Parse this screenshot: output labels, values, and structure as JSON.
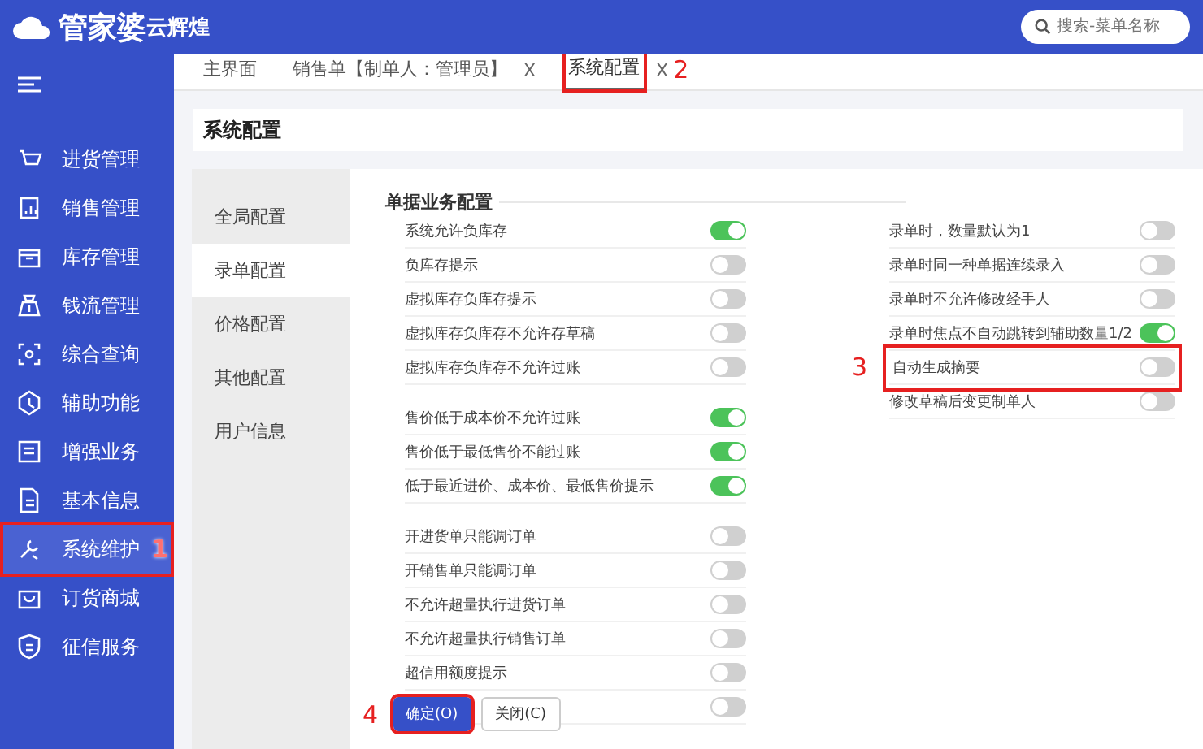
{
  "app": {
    "logo_main": "管家婆",
    "logo_sub": "云辉煌"
  },
  "search": {
    "placeholder": "搜索-菜单名称"
  },
  "sidebar": {
    "items": [
      {
        "label": "进货管理",
        "selected": false
      },
      {
        "label": "销售管理",
        "selected": false
      },
      {
        "label": "库存管理",
        "selected": false
      },
      {
        "label": "钱流管理",
        "selected": false
      },
      {
        "label": "综合查询",
        "selected": false
      },
      {
        "label": "辅助功能",
        "selected": false
      },
      {
        "label": "增强业务",
        "selected": false
      },
      {
        "label": "基本信息",
        "selected": false
      },
      {
        "label": "系统维护",
        "selected": true,
        "callout": "1"
      },
      {
        "label": "订货商城",
        "selected": false
      },
      {
        "label": "征信服务",
        "selected": false
      }
    ]
  },
  "tabs": [
    {
      "label": "主界面",
      "selected": false
    },
    {
      "label": "销售单【制单人：管理员】",
      "close": "X",
      "selected": false
    },
    {
      "label": "系统配置",
      "close": "X",
      "selected": true,
      "callout": "2"
    }
  ],
  "page_title": "系统配置",
  "config_menu": [
    {
      "label": "全局配置",
      "selected": false
    },
    {
      "label": "录单配置",
      "selected": true
    },
    {
      "label": "价格配置",
      "selected": false
    },
    {
      "label": "其他配置",
      "selected": false
    },
    {
      "label": "用户信息",
      "selected": false
    }
  ],
  "section_title": "单据业务配置",
  "left_groups": [
    [
      {
        "label": "系统允许负库存",
        "on": true
      },
      {
        "label": "负库存提示",
        "on": false
      },
      {
        "label": "虚拟库存负库存提示",
        "on": false
      },
      {
        "label": "虚拟库存负库存不允许存草稿",
        "on": false
      },
      {
        "label": "虚拟库存负库存不允许过账",
        "on": false
      }
    ],
    [
      {
        "label": "售价低于成本价不允许过账",
        "on": true
      },
      {
        "label": "售价低于最低售价不能过账",
        "on": true
      },
      {
        "label": "低于最近进价、成本价、最低售价提示",
        "on": true
      }
    ],
    [
      {
        "label": "开进货单只能调订单",
        "on": false
      },
      {
        "label": "开销售单只能调订单",
        "on": false
      },
      {
        "label": "不允许超量执行进货订单",
        "on": false
      },
      {
        "label": "不允许超量执行销售订单",
        "on": false
      },
      {
        "label": "超信用额度提示",
        "on": false
      },
      {
        "on": false
      }
    ]
  ],
  "right_settings": [
    {
      "label": "录单时，数量默认为1",
      "on": false
    },
    {
      "label": "录单时同一种单据连续录入",
      "on": false
    },
    {
      "label": "录单时不允许修改经手人",
      "on": false
    },
    {
      "label": "录单时焦点不自动跳转到辅助数量1/2",
      "on": true
    },
    {
      "label": "自动生成摘要",
      "on": false,
      "callout": "3"
    },
    {
      "label": "修改草稿后变更制单人",
      "on": false
    }
  ],
  "buttons": [
    {
      "label": "确定(O)",
      "kind": "primary",
      "callout": "4"
    },
    {
      "label": "关闭(C)",
      "kind": "plain"
    }
  ]
}
